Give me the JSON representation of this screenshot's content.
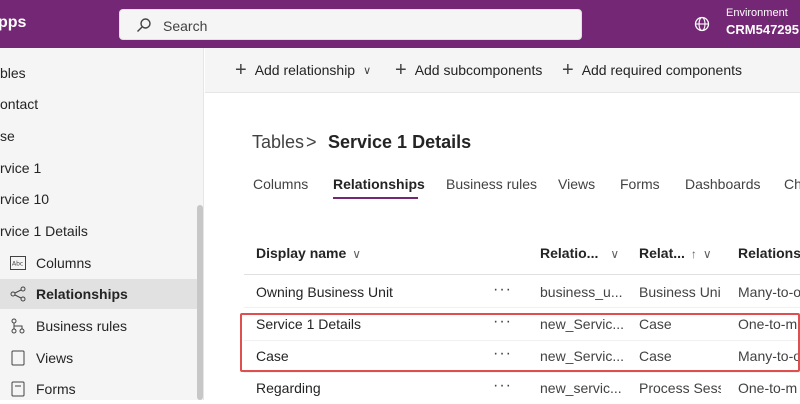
{
  "header": {
    "brand": "pps",
    "search_placeholder": "Search",
    "environment_label": "Environment",
    "environment_value": "CRM547295"
  },
  "sidebar": {
    "items": [
      {
        "label": "bles"
      },
      {
        "label": "ontact"
      },
      {
        "label": "se"
      },
      {
        "label": "rvice 1"
      },
      {
        "label": "rvice 10"
      },
      {
        "label": "rvice 1 Details"
      }
    ],
    "sub_items": [
      {
        "label": "Columns",
        "icon": "columns-icon"
      },
      {
        "label": "Relationships",
        "icon": "relationships-icon",
        "selected": true
      },
      {
        "label": "Business rules",
        "icon": "business-rules-icon"
      },
      {
        "label": "Views",
        "icon": "views-icon"
      },
      {
        "label": "Forms",
        "icon": "forms-icon"
      }
    ]
  },
  "commandbar": {
    "add_relationship": "Add relationship",
    "add_subcomponents": "Add subcomponents",
    "add_required": "Add required components",
    "more": "···"
  },
  "breadcrumb": {
    "parent": "Tables",
    "separator": ">",
    "current": "Service 1 Details"
  },
  "tabs": [
    "Columns",
    "Relationships",
    "Business rules",
    "Views",
    "Forms",
    "Dashboards",
    "Ch"
  ],
  "grid": {
    "columns": {
      "display_name": "Display name",
      "relationship_name": "Relatio...",
      "related_table": "Relat...",
      "relationship_type": "Relationsh"
    },
    "rows": [
      {
        "display": "Owning Business Unit",
        "name": "business_u...",
        "related": "Business Unit",
        "type": "Many-to-o"
      },
      {
        "display": "Service 1 Details",
        "name": "new_Servic...",
        "related": "Case",
        "type": "One-to-m"
      },
      {
        "display": "Case",
        "name": "new_Servic...",
        "related": "Case",
        "type": "Many-to-o"
      },
      {
        "display": "Regarding",
        "name": "new_servic...",
        "related": "Process Sessi",
        "type": "One-to-m"
      }
    ],
    "row_more": "···"
  },
  "colors": {
    "brand": "#742774",
    "highlight": "#e04f4f"
  }
}
